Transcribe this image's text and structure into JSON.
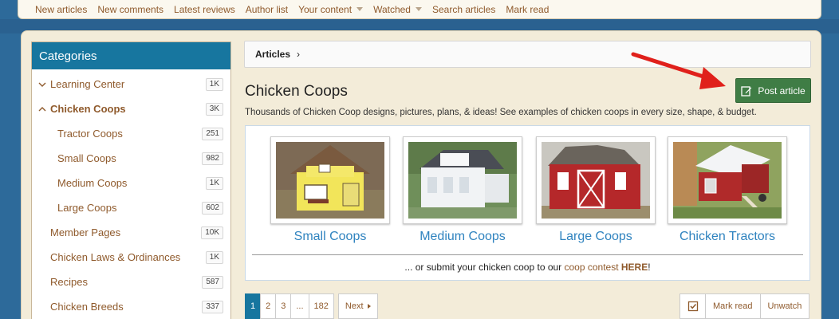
{
  "nav": {
    "items": [
      {
        "label": "New articles",
        "dropdown": false
      },
      {
        "label": "New comments",
        "dropdown": false
      },
      {
        "label": "Latest reviews",
        "dropdown": false
      },
      {
        "label": "Author list",
        "dropdown": false
      },
      {
        "label": "Your content",
        "dropdown": true
      },
      {
        "label": "Watched",
        "dropdown": true
      },
      {
        "label": "Search articles",
        "dropdown": false
      },
      {
        "label": "Mark read",
        "dropdown": false
      }
    ]
  },
  "sidebar": {
    "title": "Categories",
    "items": [
      {
        "label": "Learning Center",
        "count": "1K",
        "level": 0,
        "chevron": "down",
        "active": false
      },
      {
        "label": "Chicken Coops",
        "count": "3K",
        "level": 0,
        "chevron": "up",
        "active": true
      },
      {
        "label": "Tractor Coops",
        "count": "251",
        "level": 1,
        "chevron": "",
        "active": false
      },
      {
        "label": "Small Coops",
        "count": "982",
        "level": 1,
        "chevron": "",
        "active": false
      },
      {
        "label": "Medium Coops",
        "count": "1K",
        "level": 1,
        "chevron": "",
        "active": false
      },
      {
        "label": "Large Coops",
        "count": "602",
        "level": 1,
        "chevron": "",
        "active": false
      },
      {
        "label": "Member Pages",
        "count": "10K",
        "level": 0,
        "chevron": "",
        "active": false
      },
      {
        "label": "Chicken Laws & Ordinances",
        "count": "1K",
        "level": 0,
        "chevron": "",
        "active": false
      },
      {
        "label": "Recipes",
        "count": "587",
        "level": 0,
        "chevron": "",
        "active": false
      },
      {
        "label": "Chicken Breeds",
        "count": "337",
        "level": 0,
        "chevron": "",
        "active": false
      }
    ]
  },
  "breadcrumb": {
    "label": "Articles",
    "separator": "›"
  },
  "page": {
    "title": "Chicken Coops",
    "description": "Thousands of Chicken Coop designs, pictures, plans, & ideas! See examples of chicken coops in every size, shape, & budget.",
    "post_button": "Post article"
  },
  "showcase": {
    "tiles": [
      {
        "label": "Small Coops",
        "image": "yellow-coop-photo"
      },
      {
        "label": "Medium Coops",
        "image": "white-coop-photo"
      },
      {
        "label": "Large Coops",
        "image": "red-barn-coop-photo"
      },
      {
        "label": "Chicken Tractors",
        "image": "red-tractor-coop-photo"
      }
    ],
    "contest": {
      "prefix": "... or submit your chicken coop to our ",
      "link": "coop contest",
      "sep": " ",
      "here": "HERE",
      "suffix": "!"
    }
  },
  "pagination": {
    "pages": [
      "1",
      "2",
      "3",
      "...",
      "182"
    ],
    "current": "1",
    "next": "Next"
  },
  "actions": {
    "mark_read": "Mark read",
    "unwatch": "Unwatch"
  },
  "colors": {
    "accent": "#17769f",
    "link": "#8f5a2c",
    "post_button": "#3f7d45",
    "annotation_arrow": "#e0201b"
  }
}
